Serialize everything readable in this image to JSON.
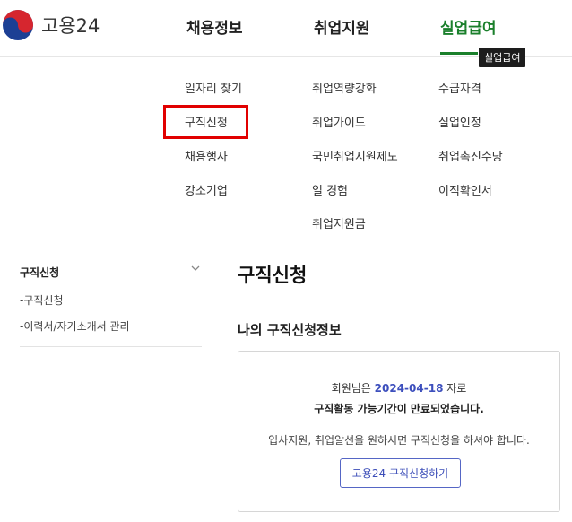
{
  "header": {
    "logo_text": "고용24",
    "nav": [
      {
        "label": "채용정보"
      },
      {
        "label": "취업지원"
      },
      {
        "label": "실업급여"
      }
    ],
    "tooltip": "실업급여"
  },
  "menu": {
    "col1": [
      "일자리 찾기",
      "구직신청",
      "채용행사",
      "강소기업"
    ],
    "col2": [
      "취업역량강화",
      "취업가이드",
      "국민취업지원제도",
      "일 경험",
      "취업지원금"
    ],
    "col3": [
      "수급자격",
      "실업인정",
      "취업촉진수당",
      "이직확인서"
    ]
  },
  "sidebar": {
    "title": "구직신청",
    "items": [
      "-구직신청",
      "-이력서/자기소개서 관리"
    ]
  },
  "main": {
    "page_title": "구직신청",
    "section_title": "나의 구직신청정보",
    "notice": {
      "line1_prefix": "회원님은 ",
      "date": "2024-04-18",
      "line1_suffix": " 자로",
      "line2": "구직활동 가능기간이 만료되었습니다.",
      "line3": "입사지원, 취업알선을 원하시면 구직신청을 하셔야 합니다.",
      "button_label": "고용24 구직신청하기"
    }
  },
  "colors": {
    "accent_green": "#1a7f2b",
    "highlight_red": "#e10000",
    "link_blue": "#3d4fbd"
  }
}
